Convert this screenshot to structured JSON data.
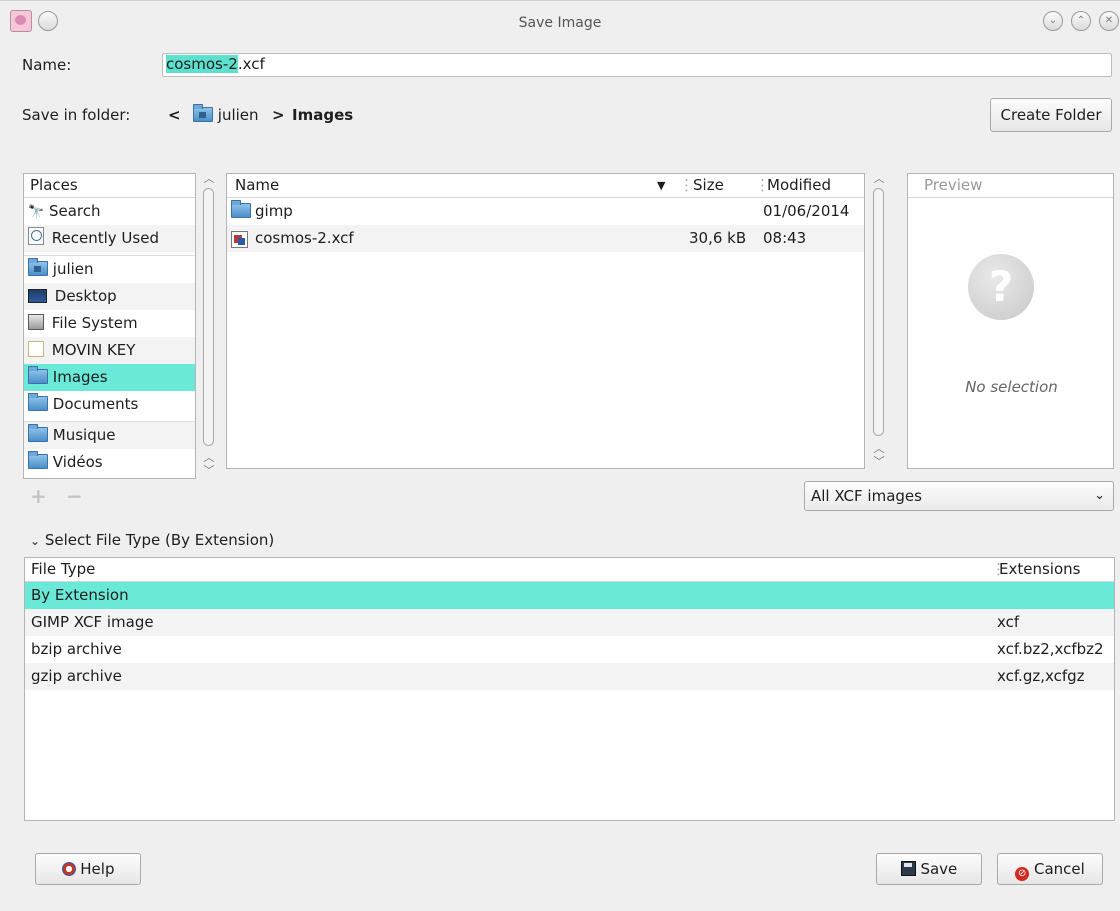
{
  "window": {
    "title": "Save Image"
  },
  "name_field": {
    "label": "Name:",
    "selected": "cosmos-2",
    "rest": ".xcf"
  },
  "folder": {
    "label": "Save in folder:",
    "back": "<",
    "crumbs": [
      {
        "label": "julien"
      },
      {
        "sep": ">"
      },
      {
        "label": "Images"
      }
    ],
    "create_folder": "Create Folder"
  },
  "places": {
    "header": "Places",
    "items": [
      {
        "label": "Search",
        "icon": "binoculars-icon"
      },
      {
        "label": "Recently Used",
        "icon": "clock-icon"
      },
      {
        "label": "julien",
        "icon": "home-folder-icon"
      },
      {
        "label": "Desktop",
        "icon": "desktop-icon"
      },
      {
        "label": "File System",
        "icon": "harddisk-icon"
      },
      {
        "label": "MOVIN KEY",
        "icon": "usb-drive-icon"
      },
      {
        "label": "Images",
        "icon": "folder-icon"
      },
      {
        "label": "Documents",
        "icon": "folder-icon"
      },
      {
        "label": "Musique",
        "icon": "folder-icon"
      },
      {
        "label": "Vidéos",
        "icon": "folder-icon"
      }
    ],
    "selected": "Images"
  },
  "files": {
    "columns": {
      "name": "Name",
      "size": "Size",
      "modified": "Modified"
    },
    "rows": [
      {
        "name": "gimp",
        "size": "",
        "modified": "01/06/2014",
        "icon": "folder-icon"
      },
      {
        "name": "cosmos-2.xcf",
        "size": "30,6 kB",
        "modified": "08:43",
        "icon": "xcf-file-icon"
      }
    ]
  },
  "preview": {
    "header": "Preview",
    "empty": "No selection"
  },
  "filter": {
    "value": "All XCF images"
  },
  "filetype": {
    "expander": "Select File Type (By Extension)",
    "columns": {
      "type": "File Type",
      "ext": "Extensions"
    },
    "rows": [
      {
        "type": "By Extension",
        "ext": ""
      },
      {
        "type": "GIMP XCF image",
        "ext": "xcf"
      },
      {
        "type": "bzip archive",
        "ext": "xcf.bz2,xcfbz2"
      },
      {
        "type": "gzip archive",
        "ext": "xcf.gz,xcfgz"
      }
    ]
  },
  "buttons": {
    "help": "Help",
    "save": "Save",
    "cancel": "Cancel"
  },
  "colors": {
    "selection": "#6ae8d8",
    "text_highlight": "#5ee0cf"
  }
}
